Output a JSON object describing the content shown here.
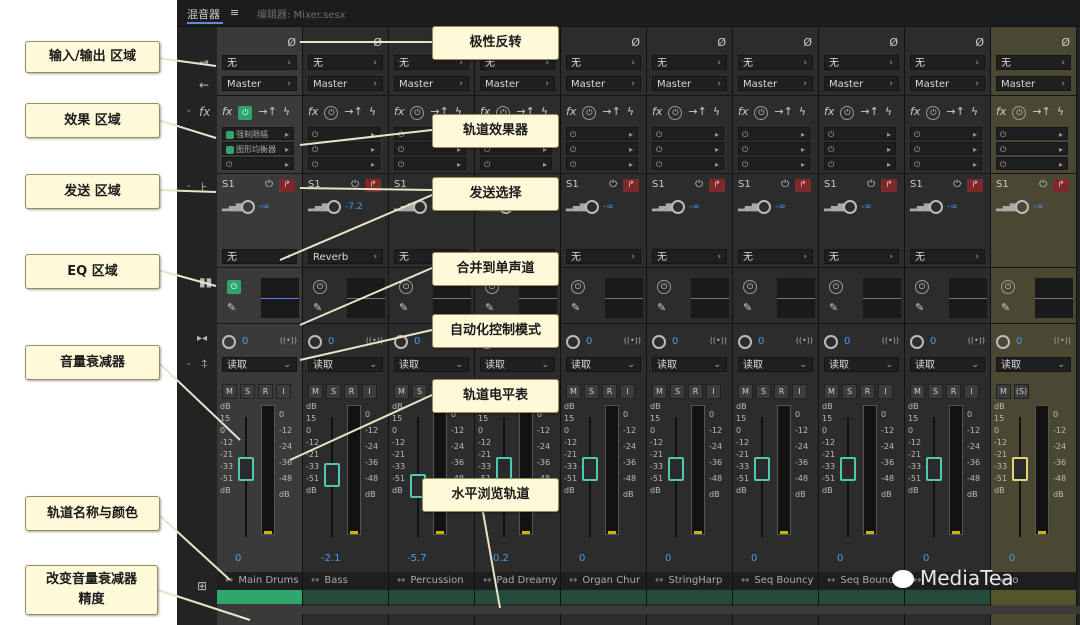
{
  "panel": {
    "tab_active": "混音器",
    "tab_menu_icon": "≡",
    "tab_inactive": "编辑器: Mixer.sesx"
  },
  "callouts": {
    "io": "输入/输出 区域",
    "fx": "效果 区域",
    "send": "发送 区域",
    "eq": "EQ 区域",
    "fader": "音量衰减器",
    "trackname": "轨道名称与颜色",
    "precision_line1": "改变音量衰减器",
    "precision_line2": "精度",
    "phase": "极性反转",
    "trackfx": "轨道效果器",
    "sendselect": "发送选择",
    "mono": "合并到单声道",
    "automode": "自动化控制模式",
    "meter": "轨道电平表",
    "hscroll": "水平浏览轨道"
  },
  "common": {
    "phase_symbol": "Ø",
    "input_none": "无",
    "output_master": "Master",
    "fx_label": "fx",
    "send_label": "S1",
    "send_none": "无",
    "mode_read": "读取",
    "m_label": "M",
    "s_label": "S",
    "r_label": "R",
    "i_label": "I",
    "s_label_alt": "(S)",
    "pan_value": "0",
    "db_label": "dB",
    "send_minus_inf": "-∞",
    "fader_scale": [
      "dB",
      "15",
      "0",
      "-12",
      "-21",
      "-33",
      "-51",
      "dB"
    ],
    "meter_scale": [
      "0",
      "-12",
      "-24",
      "-36",
      "-48",
      "dB"
    ]
  },
  "fx_slots_first": [
    "强制限幅",
    "图形均衡器"
  ],
  "icons": {
    "input_arrow": "arrow-right-icon",
    "output_arrow": "arrow-left-icon",
    "fx_icon": "fx-icon",
    "send_icon": "send-icon",
    "eq_icon": "eq-bars-icon",
    "pan_icon": "pan-icon",
    "fader_icon": "fader-icon",
    "precision_icon": "fader-precision-icon"
  },
  "tracks": [
    {
      "name": "Main Drums",
      "send_dest": "无",
      "volume": "0",
      "send_level": "-∞",
      "color": "#2fa66c"
    },
    {
      "name": "Bass",
      "send_dest": "Reverb",
      "volume": "-2.1",
      "send_level": "-7.2",
      "color": "#244a3a"
    },
    {
      "name": "Percussion",
      "send_dest": "无",
      "volume": "-5.7",
      "send_level": "-∞",
      "color": "#244a3a"
    },
    {
      "name": "Pad Dreamy",
      "send_dest": "无",
      "volume": "0.2",
      "send_level": "-∞",
      "color": "#244a3a"
    },
    {
      "name": "Organ Chur",
      "send_dest": "无",
      "volume": "0",
      "send_level": "-∞",
      "color": "#244a3a"
    },
    {
      "name": "StringHarp",
      "send_dest": "无",
      "volume": "0",
      "send_level": "-∞",
      "color": "#244a3a"
    },
    {
      "name": "Seq Bouncy",
      "send_dest": "无",
      "volume": "0",
      "send_level": "-∞",
      "color": "#244a3a"
    },
    {
      "name": "Seq Bounc",
      "send_dest": "无",
      "volume": "0",
      "send_level": "-∞",
      "color": "#244a3a"
    },
    {
      "name": "",
      "send_dest": "无",
      "volume": "0",
      "send_level": "-∞",
      "color": "#244a3a"
    },
    {
      "name": "o",
      "send_dest": "",
      "volume": "0",
      "send_level": "-∞",
      "color": "#55552a"
    }
  ],
  "watermark": "MediaTea"
}
